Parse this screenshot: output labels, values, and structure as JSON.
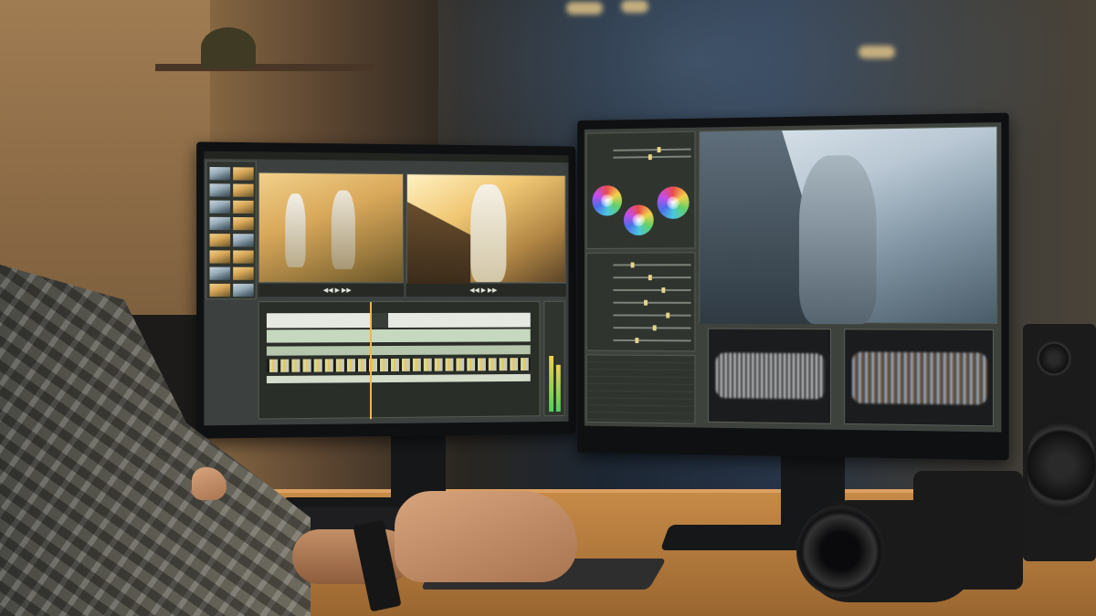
{
  "scene": {
    "description_free": true,
    "left_monitor": {
      "app": "video-editor",
      "panels": [
        "media-bin",
        "source-viewer",
        "program-viewer",
        "timeline",
        "audio-meter"
      ]
    },
    "right_monitor": {
      "app": "color-grading",
      "panels": [
        "color-controls",
        "color-wheels",
        "adjustment-sliders",
        "preview-viewer",
        "scopes",
        "presets-list"
      ]
    },
    "colors": {
      "accent_warm": "#e8b85a",
      "accent_cold": "#9aaebb",
      "desk": "#c68a47",
      "ui_panel": "#30342f"
    },
    "icons": [
      "play-icon",
      "timeline-playhead-icon",
      "color-wheel-icon",
      "speaker-icon",
      "camera-icon"
    ]
  }
}
